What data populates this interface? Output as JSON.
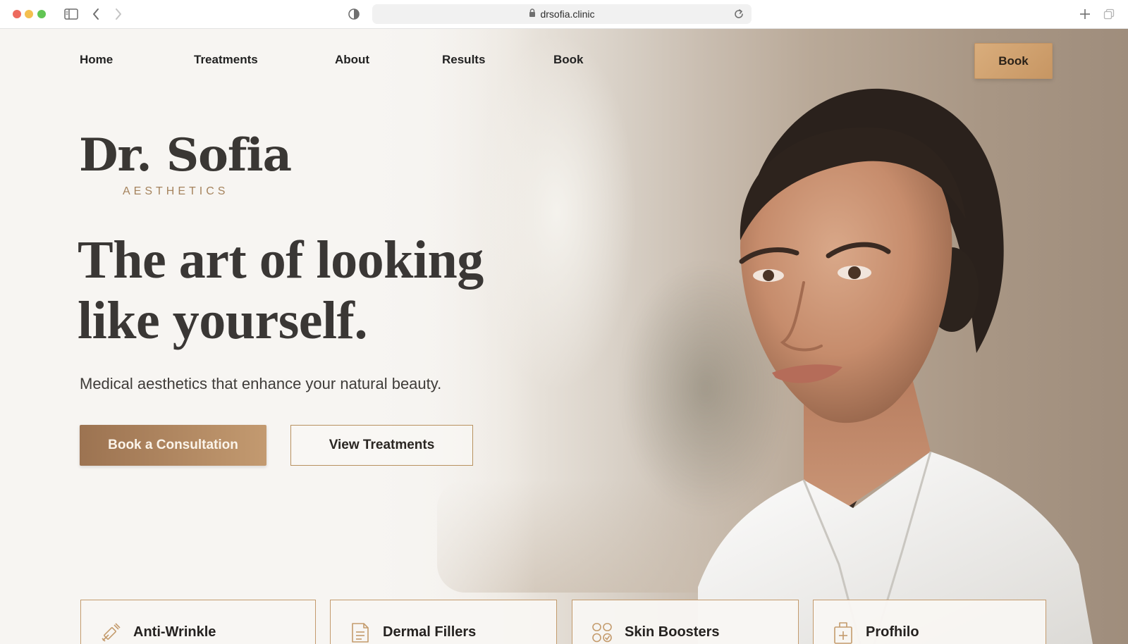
{
  "browser": {
    "url": "drsofia.clinic",
    "icons": [
      "sidebar-icon",
      "back-arrow-icon",
      "forward-arrow-icon",
      "shield-icon",
      "lock-icon",
      "reload-icon",
      "plus-icon",
      "tabs-overview-icon"
    ]
  },
  "nav": {
    "links": [
      "Home",
      "Treatments",
      "About",
      "Results",
      "Book"
    ],
    "book_button": "Book"
  },
  "brand": {
    "name": "Dr. Sofia",
    "tagline": "AESTHETICS"
  },
  "hero": {
    "headline_line1": "The art of looking",
    "headline_line2": "like yourself.",
    "subheadline": "Medical aesthetics that enhance your natural beauty.",
    "primary_cta": "Book a Consultation",
    "secondary_cta": "View Treatments"
  },
  "treatments": [
    {
      "label": "Anti-Wrinkle",
      "icon": "syringe-icon"
    },
    {
      "label": "Dermal Fillers",
      "icon": "document-icon"
    },
    {
      "label": "Skin Boosters",
      "icon": "bubbles-icon"
    },
    {
      "label": "Profhilo",
      "icon": "medical-kit-icon"
    }
  ],
  "colors": {
    "accent_gold": "#c39a6d",
    "primary_button": "#a67c56",
    "text_dark": "#3a3734",
    "background": "#f6f4f1"
  }
}
